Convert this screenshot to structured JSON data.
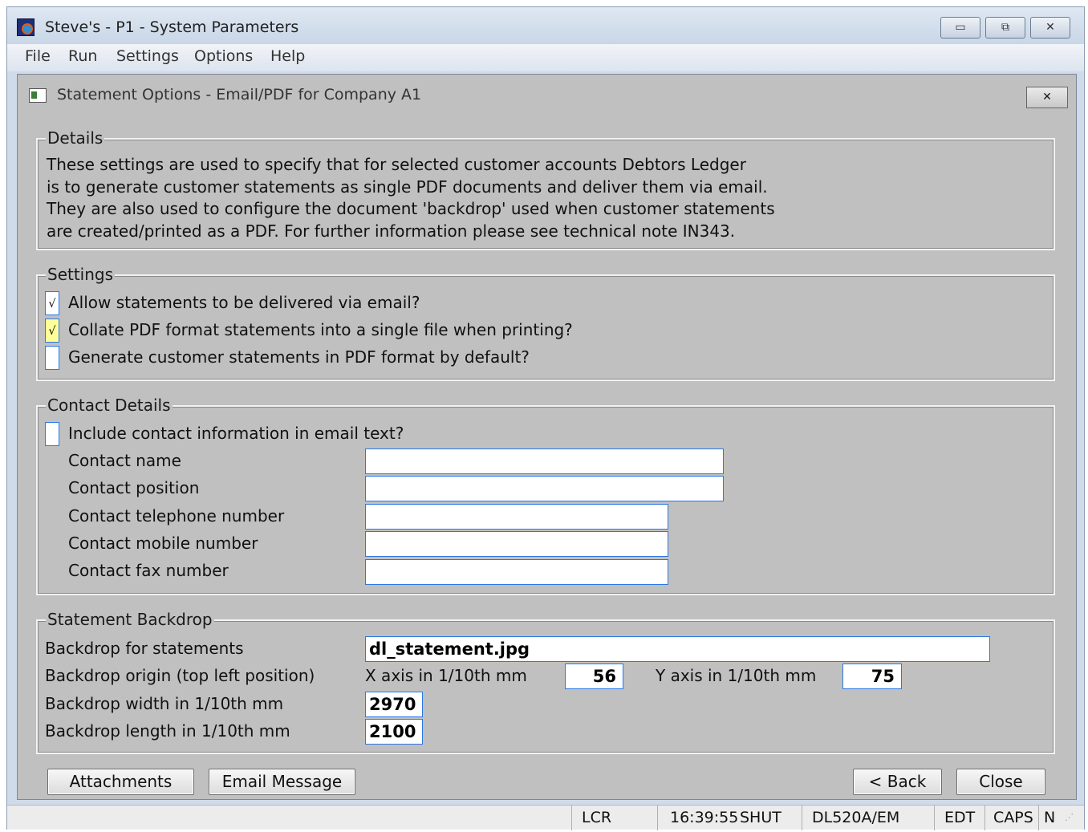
{
  "window": {
    "title": "Steve's - P1 - System Parameters",
    "minimize_glyph": "▭",
    "maximize_glyph": "⧉",
    "close_glyph": "✕"
  },
  "menu": [
    "File",
    "Run",
    "Settings",
    "Options",
    "Help"
  ],
  "dialog": {
    "title": "Statement Options - Email/PDF for Company A1",
    "close_glyph": "✕"
  },
  "details": {
    "label": "Details",
    "lines": [
      "These settings are used to specify that for selected customer accounts Debtors Ledger",
      "is to generate customer statements as single PDF documents and deliver them via email.",
      "They are also used to configure the document 'backdrop' used when customer statements",
      "are created/printed as a PDF. For further information please see technical note IN343."
    ]
  },
  "settings": {
    "label": "Settings",
    "items": [
      {
        "label": "Allow statements to be delivered via email?",
        "checked": true,
        "mark": "√"
      },
      {
        "label": "Collate PDF format statements into a single file when printing?",
        "checked": true,
        "mark": "√"
      },
      {
        "label": "Generate customer statements in PDF format by default?",
        "checked": false,
        "mark": ""
      }
    ]
  },
  "contact": {
    "label": "Contact Details",
    "include_label": "Include contact information in email text?",
    "include_checked": false,
    "fields": [
      {
        "label": "Contact name",
        "value": ""
      },
      {
        "label": "Contact position",
        "value": ""
      },
      {
        "label": "Contact telephone number",
        "value": ""
      },
      {
        "label": "Contact mobile number",
        "value": ""
      },
      {
        "label": "Contact fax number",
        "value": ""
      }
    ]
  },
  "backdrop": {
    "label": "Statement Backdrop",
    "file_label": "Backdrop for statements",
    "file_value": "dl_statement.jpg",
    "origin_label": "Backdrop origin (top left position)",
    "x_label": "X axis in 1/10th mm",
    "x_value": "56",
    "y_label": "Y axis in 1/10th mm",
    "y_value": "75",
    "width_label": "Backdrop width in 1/10th mm",
    "width_value": "2970",
    "length_label": "Backdrop length in 1/10th mm",
    "length_value": "2100"
  },
  "buttons": {
    "attachments": "Attachments",
    "email_message": "Email Message",
    "back": "< Back",
    "close": "Close"
  },
  "status": {
    "lcr": "LCR",
    "time": "16:39:55",
    "shut": "SHUT",
    "program": "DL520A/EM",
    "edt": "EDT",
    "caps": "CAPS",
    "num": "N"
  }
}
